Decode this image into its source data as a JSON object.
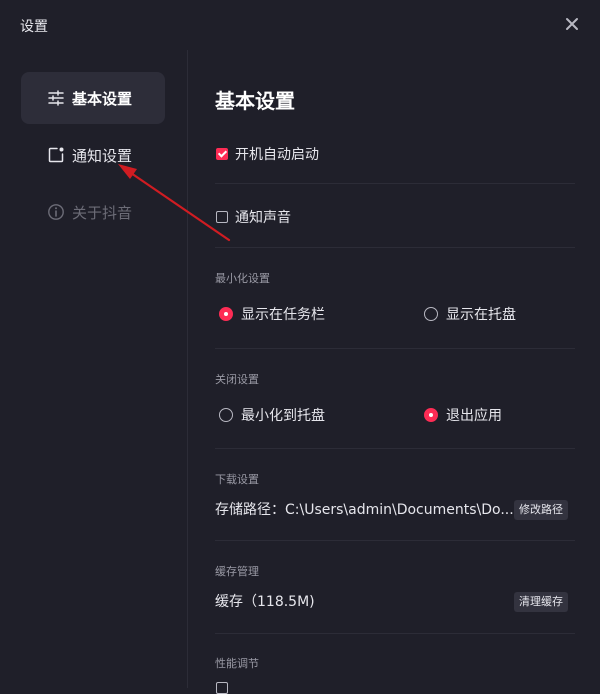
{
  "window": {
    "title": "设置"
  },
  "sidebar": {
    "items": [
      {
        "label": "基本设置",
        "icon": "sliders-icon",
        "active": true
      },
      {
        "label": "通知设置",
        "icon": "notification-icon",
        "active": false
      },
      {
        "label": "关于抖音",
        "icon": "info-icon",
        "active": false,
        "disabled": true
      }
    ]
  },
  "main": {
    "title": "基本设置",
    "auto_start": {
      "label": "开机自动启动",
      "checked": true
    },
    "notify_sound": {
      "label": "通知声音",
      "checked": false
    },
    "minimize": {
      "section": "最小化设置",
      "options": [
        {
          "label": "显示在任务栏",
          "selected": true
        },
        {
          "label": "显示在托盘",
          "selected": false
        }
      ]
    },
    "close": {
      "section": "关闭设置",
      "options": [
        {
          "label": "最小化到托盘",
          "selected": false
        },
        {
          "label": "退出应用",
          "selected": true
        }
      ]
    },
    "download": {
      "section": "下载设置",
      "path_text": "存储路径：C:\\Users\\admin\\Documents\\Do...",
      "button": "修改路径"
    },
    "cache": {
      "section": "缓存管理",
      "size_text": "缓存（118.5M)",
      "button": "清理缓存"
    },
    "performance": {
      "section": "性能调节"
    }
  },
  "colors": {
    "accent": "#fe2c55",
    "annotation_arrow": "#d01c22",
    "background": "#1f1f29"
  }
}
